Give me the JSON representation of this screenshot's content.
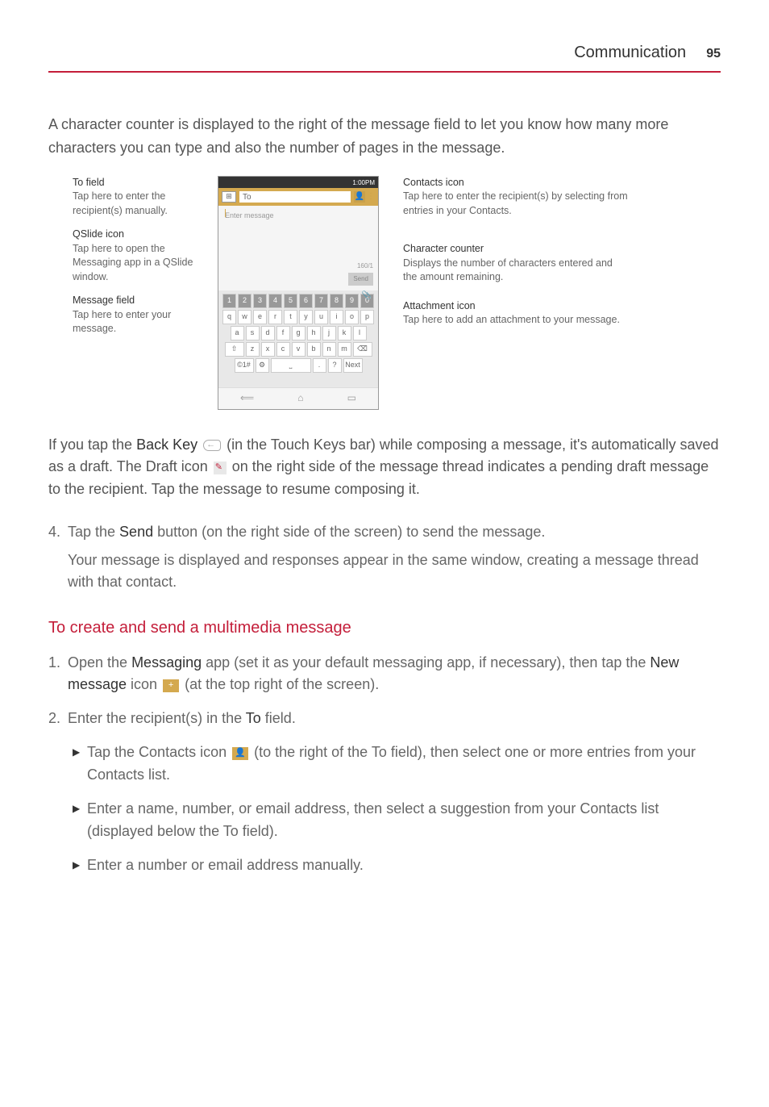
{
  "header": {
    "title": "Communication",
    "pageNumber": "95"
  },
  "intro": "A character counter is displayed to the right of the message field to let you know how many more characters you can type and also the number of pages in the message.",
  "diagram": {
    "left": {
      "toField": {
        "title": "To field",
        "desc": "Tap here to enter the recipient(s) manually."
      },
      "qslide": {
        "title": "QSlide icon",
        "desc": "Tap here to open the Messaging app in a QSlide window."
      },
      "msgField": {
        "title": "Message field",
        "desc": "Tap here to enter your message."
      }
    },
    "right": {
      "contacts": {
        "title": "Contacts icon",
        "desc": "Tap here to enter the recipient(s) by selecting from entries in your Contacts."
      },
      "counter": {
        "title": "Character counter",
        "desc": "Displays the number of characters entered and the amount remaining."
      },
      "attach": {
        "title": "Attachment icon",
        "desc": "Tap here to add an attachment to your message."
      }
    },
    "phone": {
      "time": "1:00PM",
      "toLabel": "To",
      "enterMsg": "Enter message",
      "counter": "160/1",
      "sendBtn": "Send",
      "nextBtn": "Next"
    }
  },
  "backKeyPara": {
    "p1": "If you tap the ",
    "backKey": "Back Key",
    "p2": " (in the Touch Keys bar) while composing a message, it's automatically saved as a draft. The Draft icon ",
    "p3": " on the right side of the message thread indicates a pending draft message to the recipient. Tap the message to resume composing it."
  },
  "step4": {
    "num": "4.",
    "p1": "Tap the ",
    "send": "Send",
    "p2": " button (on the right side of the screen) to send the message.",
    "p3": "Your message is displayed and responses appear in the same window, creating a message thread with that contact."
  },
  "multimediaHead": "To create and send a multimedia message",
  "mm1": {
    "num": "1.",
    "p1": "Open the ",
    "messaging": "Messaging",
    "p2": " app (set it as your default messaging app, if necessary), then tap the ",
    "newMsg": "New message",
    "p3": " icon ",
    "p4": " (at the top right of the screen)."
  },
  "mm2": {
    "num": "2.",
    "p1": "Enter the recipient(s) in the ",
    "to": "To",
    "p2": " field."
  },
  "bullet1": {
    "p1": "Tap the Contacts icon ",
    "p2": " (to the right of the To field), then select one or more entries from your Contacts list."
  },
  "bullet2": "Enter a name, number, or email address, then select a suggestion from your Contacts list (displayed below the To field).",
  "bullet3": "Enter a number or email address manually."
}
